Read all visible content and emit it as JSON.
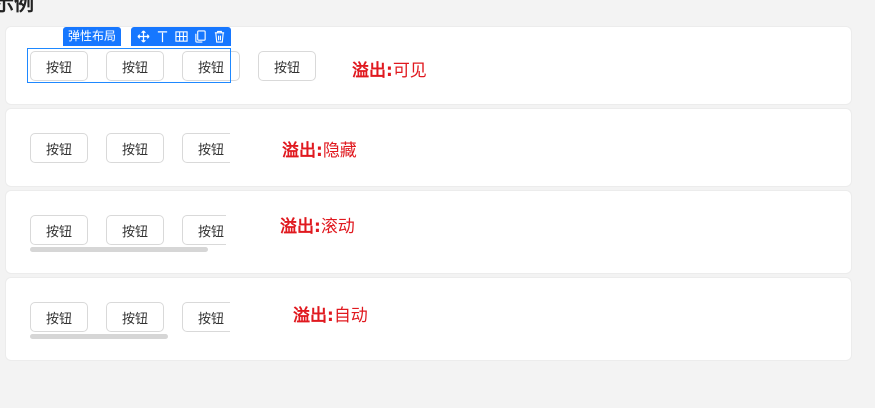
{
  "heading": "示例",
  "editor": {
    "component_tag": "弹性布局",
    "toolbar_icons": [
      "move-icon",
      "align-top-icon",
      "grid-icon",
      "copy-icon",
      "delete-icon"
    ]
  },
  "rows": [
    {
      "id": "visible",
      "buttons": [
        "按钮",
        "按钮",
        "按钮",
        "按钮"
      ],
      "label_key": "溢出:",
      "label_value": "可见"
    },
    {
      "id": "hidden",
      "buttons": [
        "按钮",
        "按钮",
        "按钮"
      ],
      "label_key": "溢出:",
      "label_value": "隐藏"
    },
    {
      "id": "scroll",
      "buttons": [
        "按钮",
        "按钮",
        "按钮"
      ],
      "label_key": "溢出:",
      "label_value": "滚动"
    },
    {
      "id": "auto",
      "buttons": [
        "按钮",
        "按钮",
        "按钮"
      ],
      "label_key": "溢出:",
      "label_value": "自动"
    }
  ],
  "colors": {
    "accent": "#1677ff",
    "label_red": "#e0191f",
    "page_bg": "#f3f3f3"
  }
}
